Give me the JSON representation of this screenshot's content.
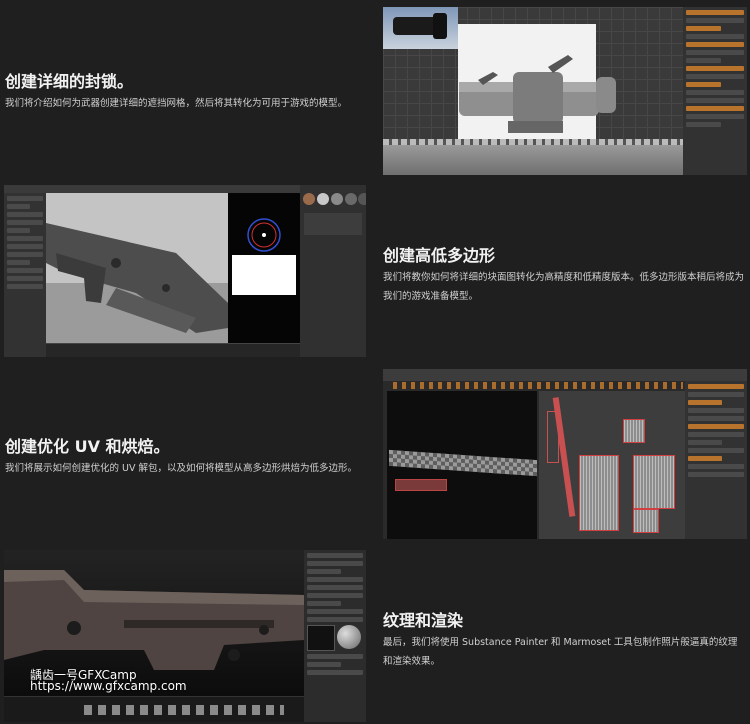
{
  "sections": [
    {
      "title": "创建详细的封锁。",
      "desc": "我们将介绍如何为武器创建详细的遮挡网格，然后将其转化为可用于游戏的模型。"
    },
    {
      "title": "创建高低多边形",
      "desc": "我们将教你如何将详细的块面图转化为高精度和低精度版本。低多边形版本稍后将成为我们的游戏准备模型。"
    },
    {
      "title": "创建优化 UV 和烘焙。",
      "desc": "我们将展示如何创建优化的 UV 解包，以及如何将模型从高多边形烘焙为低多边形。"
    },
    {
      "title": "纹理和渲染",
      "desc": "最后，我们将使用 Substance Painter 和 Marmoset 工具包制作照片般逼真的纹理和渲染效果。"
    }
  ],
  "watermark": {
    "line1": "龋齿一号GFXCamp",
    "line2": "https://www.gfxcamp.com"
  },
  "colors": {
    "background": "#1f1f1f",
    "accent_orange": "#b8742c",
    "uv_red": "#d04040"
  }
}
